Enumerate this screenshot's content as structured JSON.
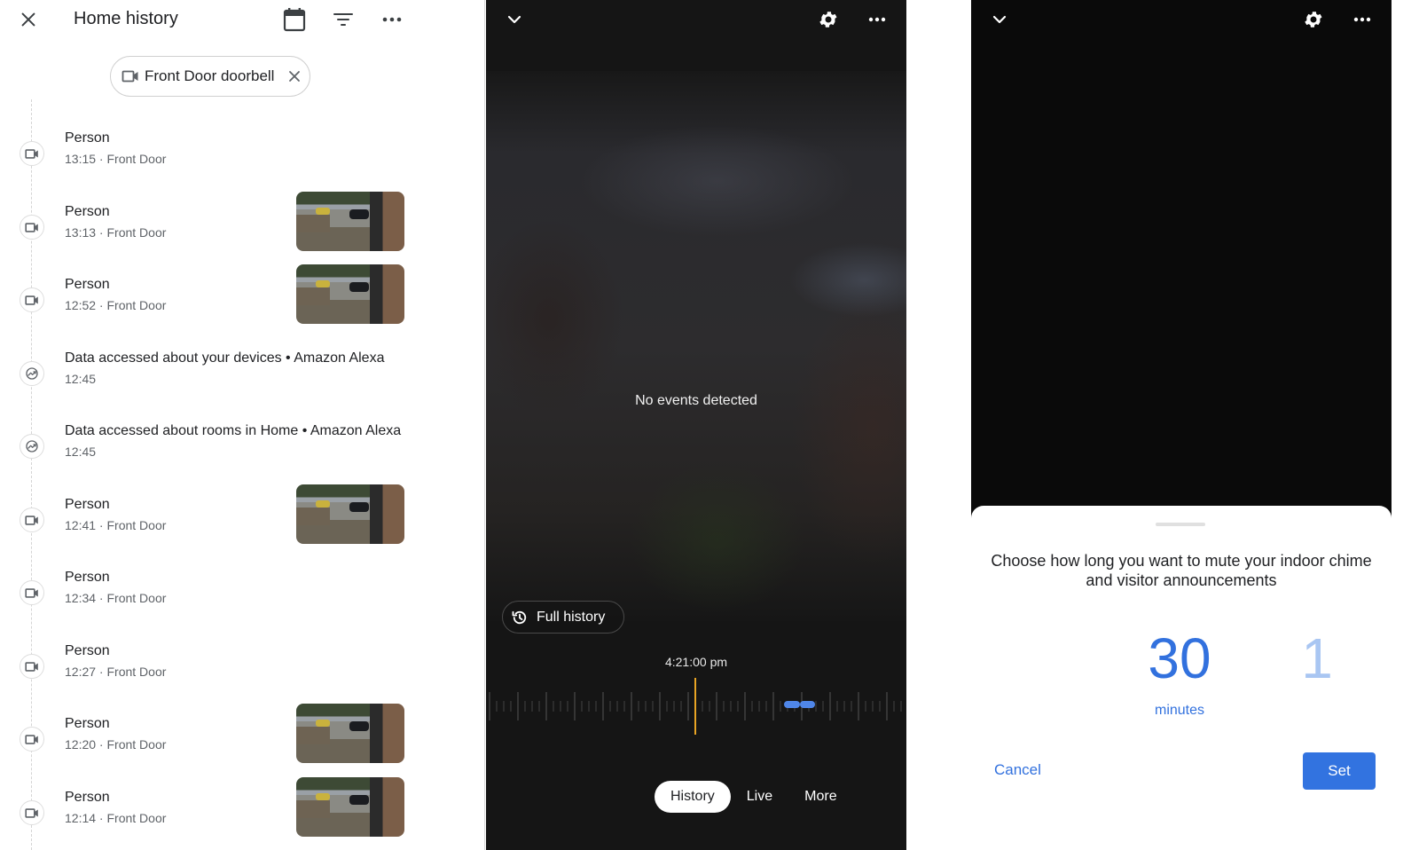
{
  "history_panel": {
    "title": "Home history",
    "icons": {
      "close": "close-icon",
      "calendar": "calendar-icon",
      "filter": "filter-icon",
      "more": "more-horiz-icon"
    },
    "filter_chip": {
      "label": "Front Door doorbell",
      "icon": "videocam-icon",
      "remove_icon": "close-icon"
    },
    "events": [
      {
        "title": "Person",
        "subtitle": "13:15 · Front Door",
        "icon": "videocam-icon",
        "has_thumbnail": false
      },
      {
        "title": "Person",
        "subtitle": "13:13 · Front Door",
        "icon": "videocam-icon",
        "has_thumbnail": true
      },
      {
        "title": "Person",
        "subtitle": "12:52 · Front Door",
        "icon": "videocam-icon",
        "has_thumbnail": true
      },
      {
        "title": "Data accessed about your devices • Amazon Alexa",
        "subtitle": "12:45",
        "icon": "data-access-icon",
        "has_thumbnail": false
      },
      {
        "title": "Data accessed about rooms in Home • Amazon Alexa",
        "subtitle": "12:45",
        "icon": "data-access-icon",
        "has_thumbnail": false
      },
      {
        "title": "Person",
        "subtitle": "12:41 · Front Door",
        "icon": "videocam-icon",
        "has_thumbnail": true
      },
      {
        "title": "Person",
        "subtitle": "12:34 · Front Door",
        "icon": "videocam-icon",
        "has_thumbnail": false
      },
      {
        "title": "Person",
        "subtitle": "12:27 · Front Door",
        "icon": "videocam-icon",
        "has_thumbnail": false
      },
      {
        "title": "Person",
        "subtitle": "12:20 · Front Door",
        "icon": "videocam-icon",
        "has_thumbnail": true
      },
      {
        "title": "Person",
        "subtitle": "12:14 · Front Door",
        "icon": "videocam-icon",
        "has_thumbnail": true
      }
    ]
  },
  "camera_panel": {
    "icons": {
      "collapse": "chevron-down-icon",
      "settings": "gear-icon",
      "more": "more-horiz-icon"
    },
    "status_text": "No events detected",
    "full_history_label": "Full history",
    "full_history_icon": "history-icon",
    "current_time": "4:21:00 pm",
    "tabs": [
      {
        "label": "History",
        "active": true
      },
      {
        "label": "Live",
        "active": false
      },
      {
        "label": "More",
        "active": false
      }
    ],
    "colors": {
      "playhead": "#e8a424",
      "event_segment": "#4f86e8"
    }
  },
  "mute_panel": {
    "icons": {
      "collapse": "chevron-down-icon",
      "settings": "gear-icon",
      "more": "more-horiz-icon"
    },
    "prompt": "Choose how long you want to mute your indoor chime and visitor announcements",
    "selected_value": "30",
    "next_value": "1",
    "unit": "minutes",
    "cancel_label": "Cancel",
    "set_label": "Set",
    "colors": {
      "accent": "#3271de"
    }
  }
}
